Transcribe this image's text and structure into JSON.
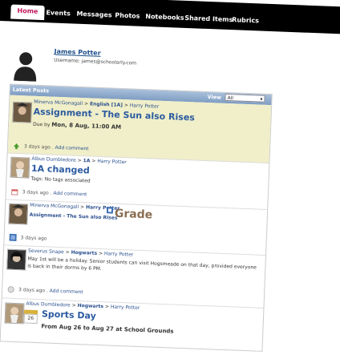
{
  "nav": {
    "items": [
      "Home",
      "Events",
      "Messages",
      "Photos",
      "Notebooks",
      "Shared Items",
      "Rubrics"
    ]
  },
  "profile": {
    "name": "James Potter",
    "username": "Username: james@schoolarly.com"
  },
  "feed": {
    "title": "Latest Posts",
    "view_label": "View",
    "view_value": "All",
    "posts": [
      {
        "author": "Minerva McGonagall",
        "path1": "English [1A]",
        "path2": "Harry Potter",
        "title": "Assignment - The Sun also Rises",
        "due_prefix": "Due by",
        "due_value": "Mon, 8 Aug, 11:00 AM",
        "time": "3 days ago",
        "action": "Add comment"
      },
      {
        "author": "Albus Dumbledore",
        "path1": "1A",
        "path2": "Harry Potter",
        "title": "1A changed",
        "tags": "Tags: No tags associated",
        "time": "3 days ago",
        "action": "Add comment"
      },
      {
        "author": "Minerva McGonagall",
        "path1": "Harry Potter",
        "linked": "Assignment - The Sun also Rises",
        "grade": "Grade",
        "time": "3 days ago"
      },
      {
        "author": "Severus Snape",
        "path1": "Hogwarts",
        "path2": "Harry Potter",
        "body": "May 1st will be a holiday. Senior students can visit Hogsmeade on that day, provided everyone is back in their dorms by 6 PM.",
        "time": "3 days ago",
        "action": "Add comment"
      },
      {
        "author": "Albus Dumbledore",
        "path1": "Hogwarts",
        "path2": "Harry Potter",
        "title": "Sports Day",
        "cal_day": "26",
        "dates": "From Aug 26 to Aug 27 at School Grounds"
      }
    ]
  },
  "colors": {
    "accent": "#c2185b",
    "link": "#2b5aa0",
    "highlight": "#f0efc9"
  }
}
